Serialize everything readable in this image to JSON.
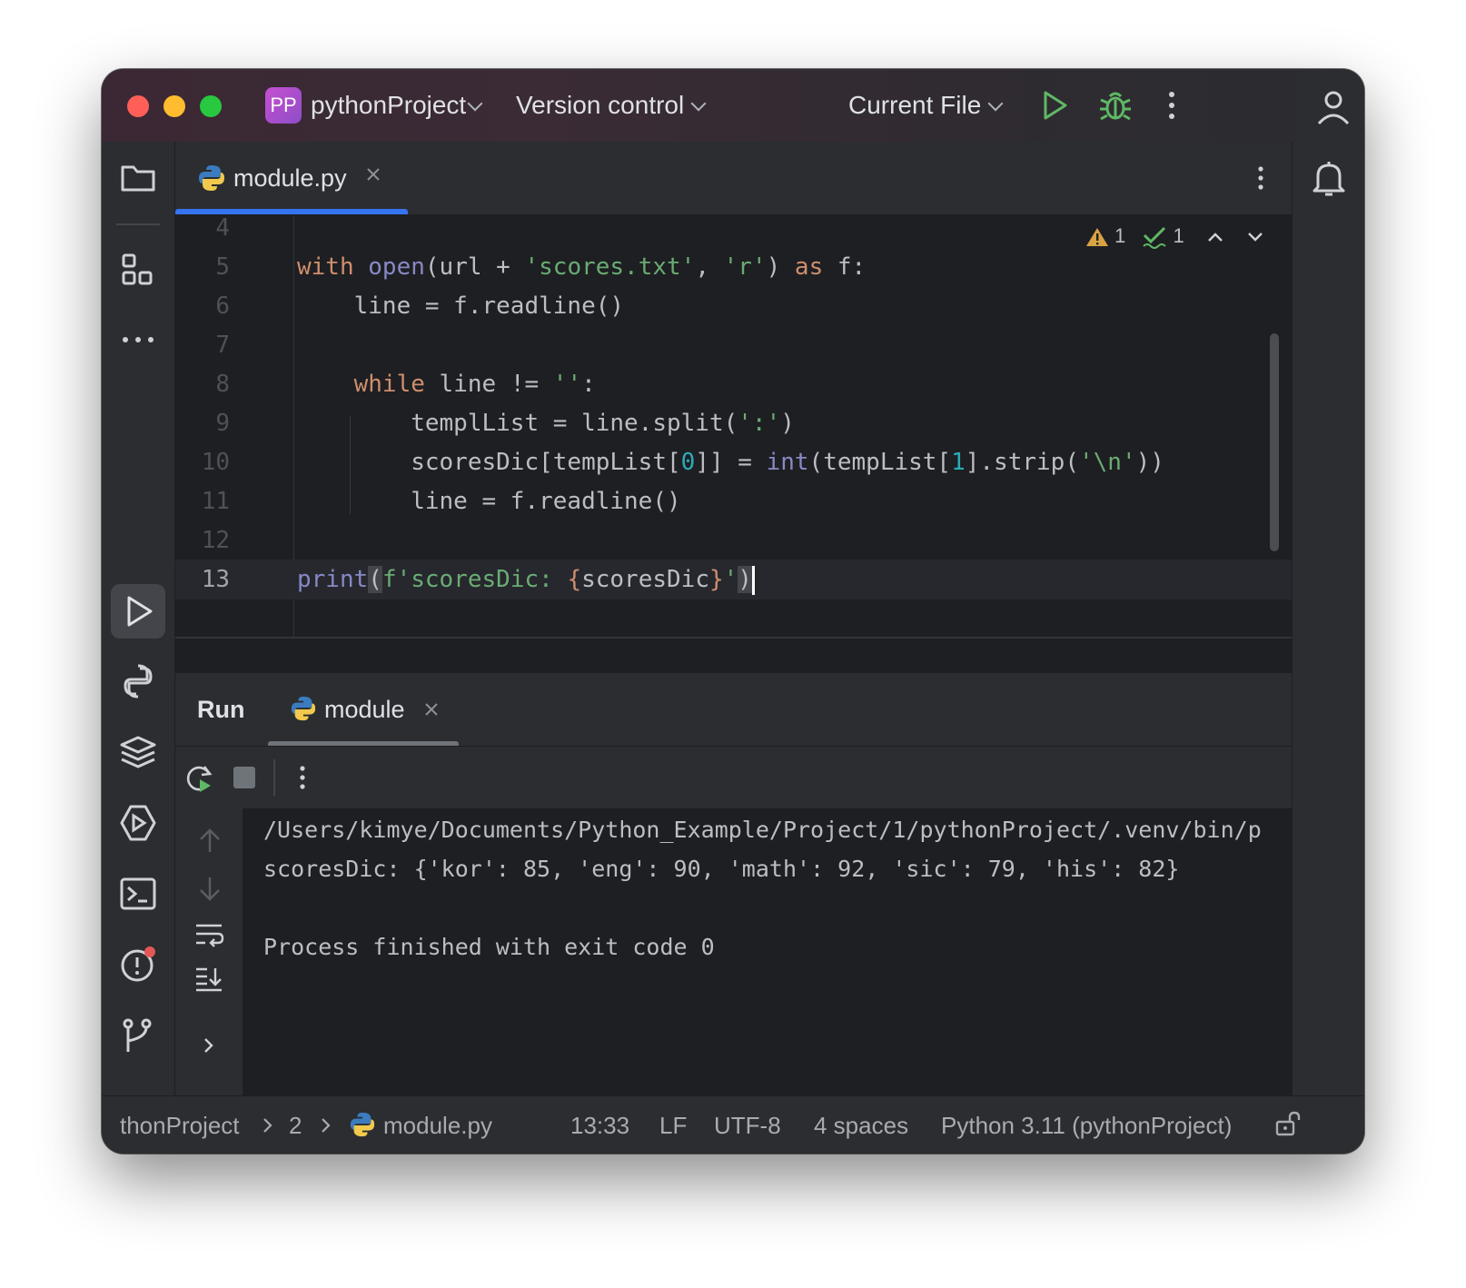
{
  "titlebar": {
    "project_badge": "PP",
    "project_name": "pythonProject",
    "vcs": "Version control",
    "run_config": "Current File"
  },
  "editor": {
    "tab": {
      "name": "module.py",
      "icon": "python-icon"
    },
    "inspections": {
      "warnings": "1",
      "weak_warnings": "1"
    },
    "lines": [
      {
        "num": "4"
      },
      {
        "num": "5"
      },
      {
        "num": "6"
      },
      {
        "num": "7"
      },
      {
        "num": "8"
      },
      {
        "num": "9"
      },
      {
        "num": "10"
      },
      {
        "num": "11"
      },
      {
        "num": "12"
      },
      {
        "num": "13"
      }
    ],
    "code": {
      "l5": [
        "with",
        " ",
        "open",
        "(url + ",
        "'scores.txt'",
        ", ",
        "'r'",
        ") ",
        "as",
        " f:"
      ],
      "l6": "    line = f.readline()",
      "l8": [
        "    ",
        "while",
        " line != ",
        "''",
        ":"
      ],
      "l9": [
        "        templList = line.split(",
        "':'",
        ")"
      ],
      "l10": [
        "        scoresDic[tempList[",
        "0",
        "]] = ",
        "int",
        "(tempList[",
        "1",
        "].strip(",
        "'\\n'",
        "))"
      ],
      "l11": "        line = f.readline()",
      "l13": [
        "print",
        "(",
        "f'scoresDic: ",
        "{",
        "scoresDic",
        "}",
        "'",
        ")"
      ]
    }
  },
  "run_panel": {
    "title": "Run",
    "tab": "module",
    "output": [
      "/Users/kimye/Documents/Python_Example/Project/1/pythonProject/.venv/bin/p",
      "scoresDic: {'kor': 85, 'eng': 90, 'math': 92, 'sic': 79, 'his': 82}",
      "",
      "Process finished with exit code 0"
    ]
  },
  "statusbar": {
    "breadcrumb": [
      "thonProject",
      "2",
      "module.py"
    ],
    "position": "13:33",
    "line_sep": "LF",
    "encoding": "UTF-8",
    "indent": "4 spaces",
    "interpreter": "Python 3.11 (pythonProject)"
  },
  "colors": {
    "accent": "#3574f0",
    "keyword": "#cf8e6d",
    "string": "#6aab73",
    "number": "#2aacb8",
    "builtin": "#8888c6",
    "run_green": "#5fb865"
  }
}
